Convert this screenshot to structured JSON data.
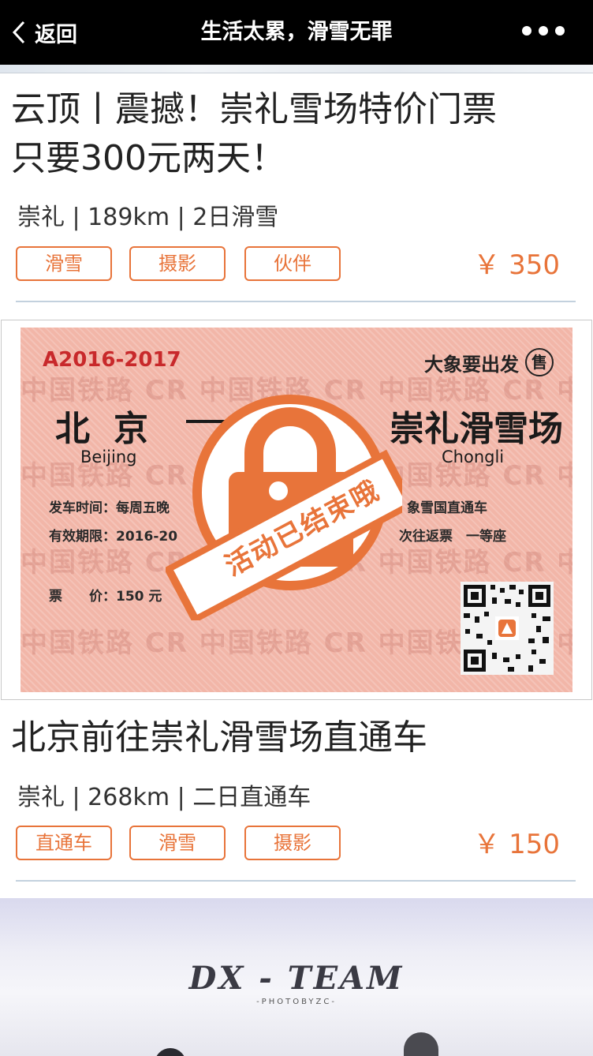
{
  "nav": {
    "back_label": "返回",
    "title": "生活太累，滑雪无罪"
  },
  "cards": [
    {
      "title_line1": "云顶丨震撼！崇礼雪场特价门票",
      "title_line2": "只要300元两天！",
      "meta": "崇礼 | 189km | 2日滑雪",
      "tags": [
        "滑雪",
        "摄影",
        "伙伴"
      ],
      "price": "￥ 350"
    },
    {
      "title": "北京前往崇礼滑雪场直通车",
      "meta": "崇礼 | 268km | 二日直通车",
      "tags": [
        "直通车",
        "滑雪",
        "摄影"
      ],
      "price": "￥ 150"
    }
  ],
  "ticket": {
    "code": "A2016-2017",
    "seller": "大象要出发",
    "seller_icon_text": "售",
    "from": "北京",
    "from_en": "Beijing",
    "to": "崇礼滑雪场",
    "to_en": "Chongli",
    "depart_time": "发车时间：每周五晚",
    "valid": "有效期限：2016-20",
    "train": "象雪国直通车",
    "seat": "次往返票　一等座",
    "price_text": "票　　价：150 元",
    "watermark": "中国铁路 CR 中国铁路 CR 中国铁路 CR 中国铁路"
  },
  "badge": {
    "text": "活动已结束哦"
  },
  "banner": {
    "logo": "DX - TEAM",
    "sub": "-PHOTOBYZC-"
  },
  "colors": {
    "accent": "#e8743a",
    "ticket_bg": "#f2b6a8",
    "navbar": "#000000"
  }
}
